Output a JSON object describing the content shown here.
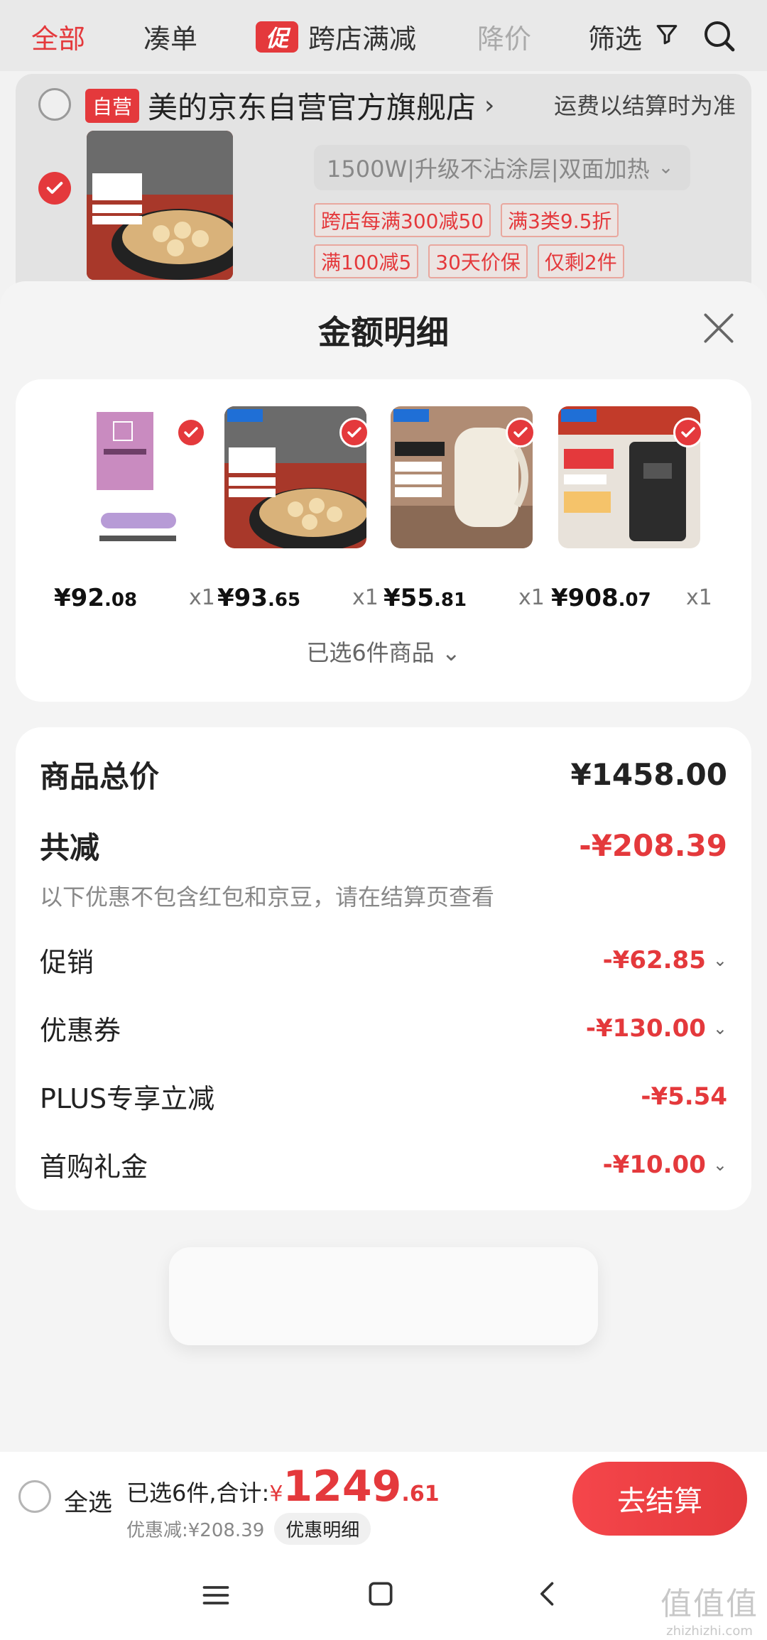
{
  "topbar": {
    "tab_all": "全部",
    "tab_cou": "凑单",
    "promo_badge": "促",
    "tab_promo": "跨店满减",
    "tab_down": "降价",
    "tab_filter": "筛选"
  },
  "store": {
    "self_badge": "自营",
    "name": "美的京东自营官方旗舰店",
    "ship_note": "运费以结算时为准",
    "spec": "1500W|升级不沾涂层|双面加热",
    "tags_row1": [
      "跨店每满300减50",
      "满3类9.5折"
    ],
    "tags_row2": [
      "满100减5",
      "30天价保",
      "仅剩2件"
    ]
  },
  "sheet": {
    "title": "金额明细",
    "goods": [
      {
        "price_int": "¥92",
        "price_dec": ".08",
        "qty": "x1"
      },
      {
        "price_int": "¥93",
        "price_dec": ".65",
        "qty": "x1"
      },
      {
        "price_int": "¥55",
        "price_dec": ".81",
        "qty": "x1"
      },
      {
        "price_int": "¥908",
        "price_dec": ".07",
        "qty": "x1"
      }
    ],
    "selected_count": "已选6件商品"
  },
  "amounts": {
    "total_label": "商品总价",
    "total_value": "¥1458.00",
    "reduce_label": "共减",
    "reduce_value": "-¥208.39",
    "reduce_note": "以下优惠不包含红包和京豆，请在结算页查看",
    "details": [
      {
        "label": "促销",
        "value": "-¥62.85"
      },
      {
        "label": "优惠券",
        "value": "-¥130.00"
      },
      {
        "label": "PLUS专享立减",
        "value": "-¥5.54"
      },
      {
        "label": "首购礼金",
        "value": "-¥10.00"
      }
    ]
  },
  "checkout": {
    "select_all": "全选",
    "summary_prefix": "已选6件,合计:",
    "yen": "¥",
    "total_int": "1249",
    "total_dec": ".61",
    "discount": "优惠减:¥208.39",
    "detail_button": "优惠明细",
    "checkout_button": "去结算"
  },
  "watermark": {
    "main": "值值值",
    "sub": "zhizhizhi.com"
  },
  "colors": {
    "accent": "#e4393c"
  }
}
